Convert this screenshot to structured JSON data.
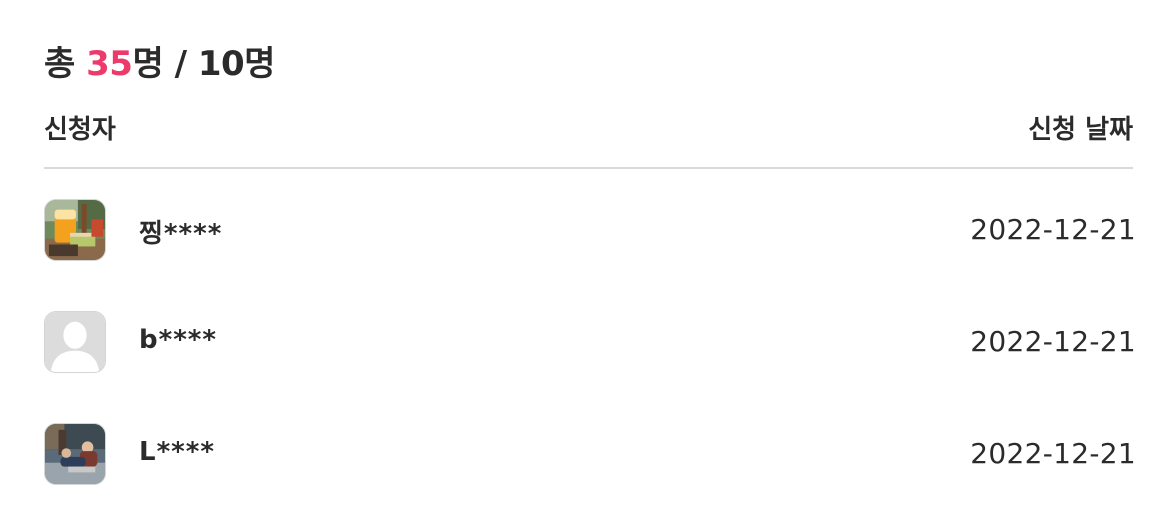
{
  "summary": {
    "prefix": "총 ",
    "count": "35",
    "suffix": "명 / 10명",
    "accent_color": "#ec3b6a"
  },
  "table": {
    "headers": {
      "applicant": "신청자",
      "date": "신청 날짜"
    },
    "rows": [
      {
        "name": "찡****",
        "date": "2022-12-21",
        "avatar": "photo-drink-avatar"
      },
      {
        "name": "b****",
        "date": "2022-12-21",
        "avatar": "default-user-avatar"
      },
      {
        "name": "L****",
        "date": "2022-12-21",
        "avatar": "photo-people-avatar"
      }
    ]
  }
}
